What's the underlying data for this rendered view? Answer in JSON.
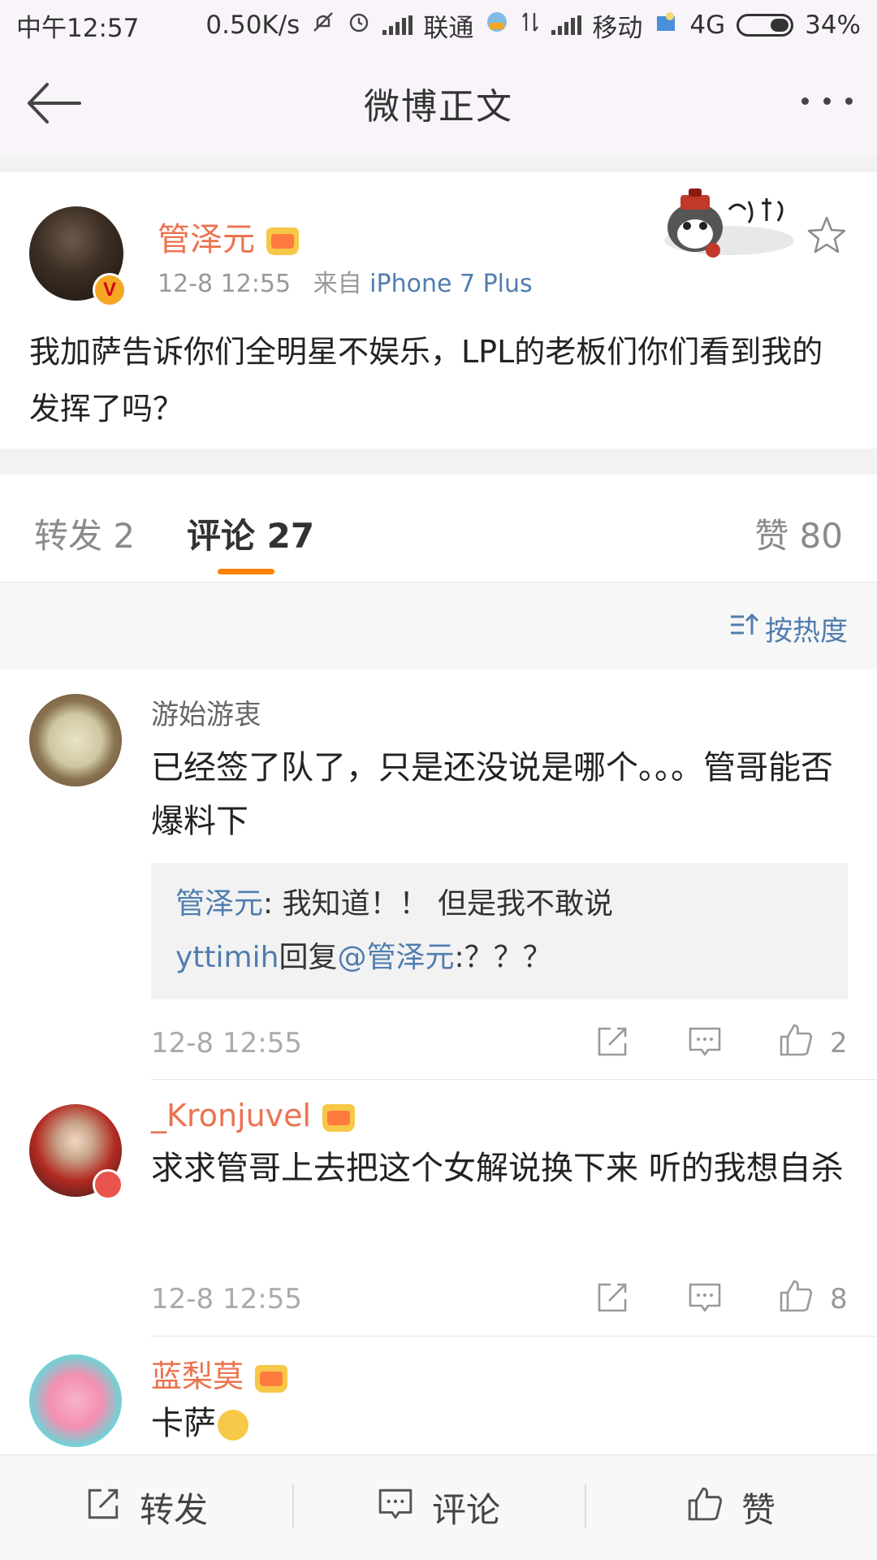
{
  "status_bar": {
    "time": "中午12:57",
    "speed": "0.50K/s",
    "carrier1": "联通",
    "carrier2": "移动",
    "network": "4G",
    "battery": "34%"
  },
  "nav": {
    "title": "微博正文",
    "back_icon": "arrow-left-icon",
    "more_icon": "more-dots-icon"
  },
  "post": {
    "author": "管泽元",
    "time": "12-8 12:55",
    "source_prefix": "来自",
    "source": "iPhone 7 Plus",
    "text": "我加萨告诉你们全明星不娱乐，LPL的老板们你们看到我的发挥了吗？",
    "verified_badge": "V"
  },
  "tabs": {
    "repost": "转发 2",
    "comment": "评论 27",
    "like": "赞 80"
  },
  "sort": {
    "label": "按热度"
  },
  "comments": [
    {
      "name": "游始游衷",
      "text": "已经签了队了，只是还没说是哪个。。。管哥能否爆料下",
      "reply1_user": "管泽元",
      "reply1_text": ": 我知道！！ 但是我不敢说",
      "reply2_user": "yttimih",
      "reply2_mid": "回复",
      "reply2_at": "@管泽元",
      "reply2_text": ":？？？",
      "time": "12-8 12:55",
      "likes": "2"
    },
    {
      "name": "_Kronjuvel",
      "text": "求求管哥上去把这个女解说换下来 听的我想自杀",
      "time": "12-8 12:55",
      "likes": "8"
    },
    {
      "name": "蓝梨莫",
      "text": "卡萨"
    }
  ],
  "bottom_bar": {
    "repost": "转发",
    "comment": "评论",
    "like": "赞"
  },
  "colors": {
    "accent": "#ff8200",
    "name_orange": "#eb7350",
    "link_blue": "#507daf"
  }
}
